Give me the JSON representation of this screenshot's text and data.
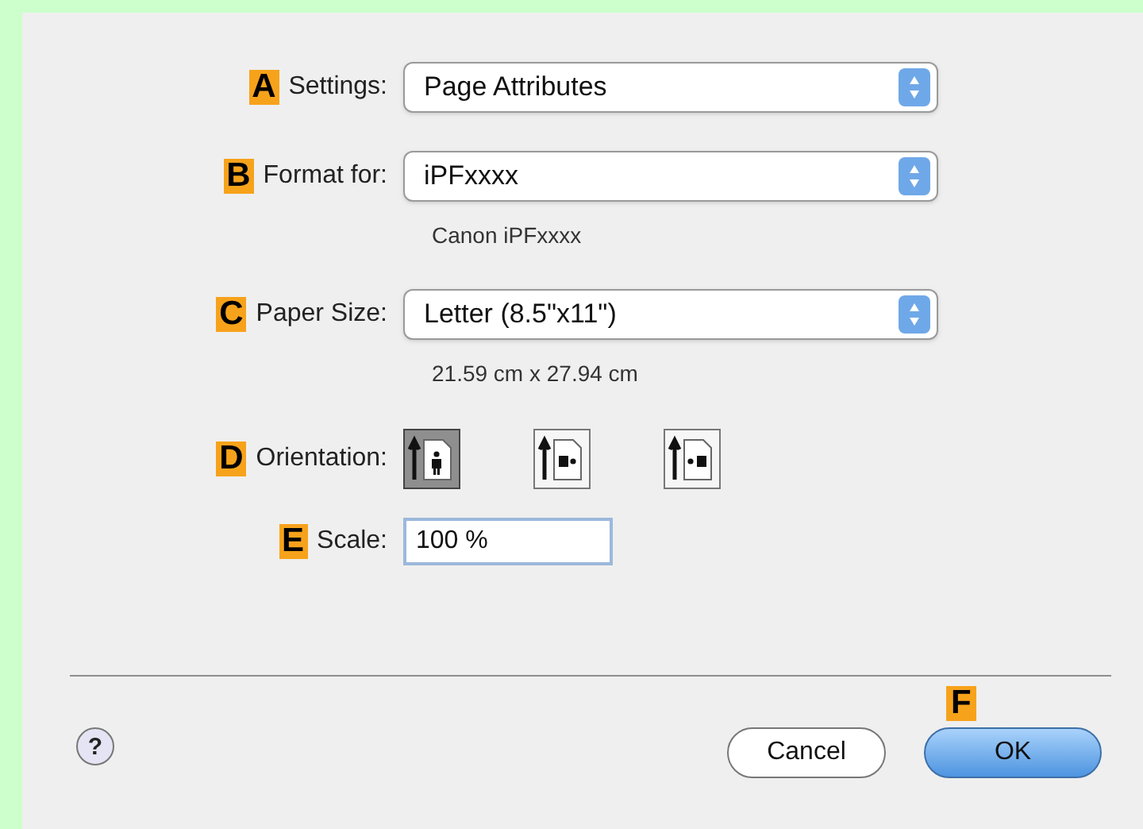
{
  "rows": [
    {
      "kind": "popup",
      "marker": "A",
      "label": "Settings:",
      "value": "Page Attributes"
    },
    {
      "kind": "popup",
      "marker": "B",
      "label": "Format for:",
      "value": "iPFxxxx"
    },
    {
      "kind": "note",
      "text": "Canon iPFxxxx"
    },
    {
      "kind": "popup",
      "marker": "C",
      "label": "Paper Size:",
      "value": "Letter (8.5\"x11\")"
    },
    {
      "kind": "note",
      "text": "21.59 cm x 27.94 cm"
    },
    {
      "kind": "orientation",
      "marker": "D",
      "label": "Orientation:",
      "options": [
        {
          "kind": "portrait",
          "selected": true
        },
        {
          "kind": "landscape-left",
          "selected": false
        },
        {
          "kind": "landscape-right",
          "selected": false
        }
      ]
    },
    {
      "kind": "field",
      "marker": "E",
      "label": "Scale:",
      "value": "100 %"
    }
  ],
  "footer": {
    "help": "?",
    "buttons": [
      {
        "label": "Cancel",
        "default": false
      },
      {
        "label": "OK",
        "default": true,
        "marker": "F"
      }
    ]
  }
}
